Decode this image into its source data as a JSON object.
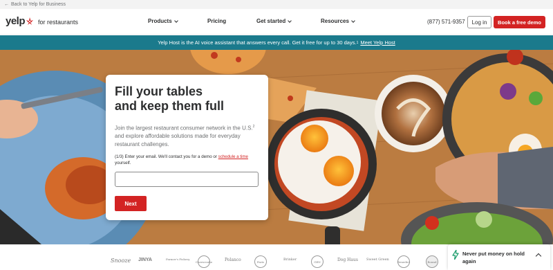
{
  "topbar": {
    "back_label": "Back to Yelp for Business"
  },
  "nav": {
    "logo_word": "yelp",
    "logo_sub": "for restaurants",
    "items": [
      {
        "label": "Products",
        "has_dropdown": true
      },
      {
        "label": "Pricing",
        "has_dropdown": false
      },
      {
        "label": "Get started",
        "has_dropdown": true
      },
      {
        "label": "Resources",
        "has_dropdown": true
      }
    ],
    "phone": "(877) 571-9357",
    "login_label": "Log in",
    "demo_label": "Book a free demo"
  },
  "banner": {
    "text": "Yelp Host is the AI voice assistant that answers every call. Get it free for up to 30 days.",
    "sup": "1",
    "link": "Meet Yelp Host"
  },
  "hero": {
    "title_line1": "Fill your tables",
    "title_line2": "and keep them full",
    "desc_before": "Join the largest restaurant consumer network in the U.S.",
    "desc_sup": "2",
    "desc_after": " and explore affordable solutions made for everyday restaurant challenges.",
    "step_before": "(1/3) Enter your email. We'll contact you for a demo or ",
    "step_link": "schedule a time",
    "step_after": " yourself.",
    "email_placeholder": "",
    "next_label": "Next"
  },
  "logos": [
    "Snooze",
    "JINYA",
    "Farmer's Fishery",
    "Cheesecake",
    "Polanco",
    "Paris",
    "Brinker",
    "GEN",
    "Dog Haus",
    "Sweet Green",
    "Benedict",
    "Round"
  ],
  "toast": {
    "text": "Never put money on hold again"
  },
  "colors": {
    "brand_red": "#d32323",
    "banner_teal": "#1b7a8c",
    "text_dark": "#2d2e2f",
    "text_gray": "#6e7072"
  }
}
